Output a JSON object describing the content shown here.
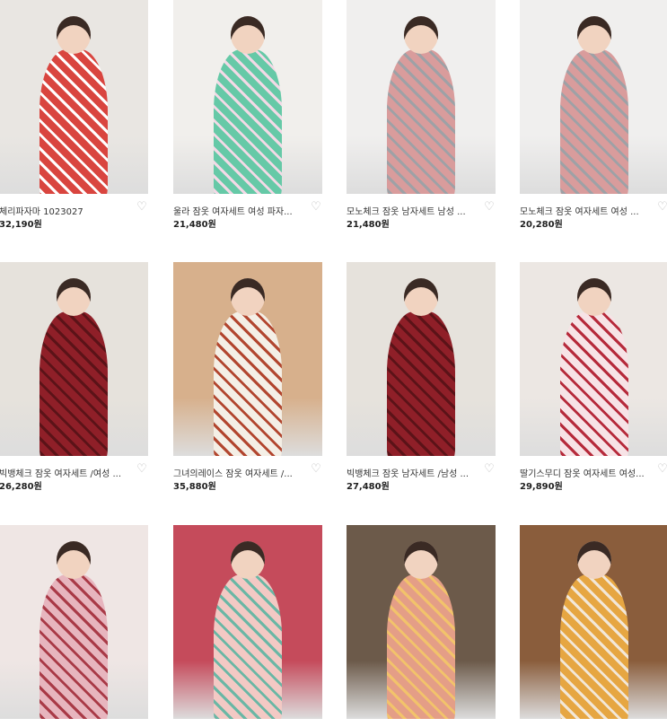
{
  "products": [
    {
      "title": "체리파자마 1023027",
      "price": "32,190원",
      "bg": "#e9e6e2",
      "outfit": "#d9453f",
      "accent": "#ffffff",
      "heart_icon": "heart-outline-icon"
    },
    {
      "title": "울라 잠옷 여자세트 여성 파자...",
      "price": "21,480원",
      "bg": "#f1efec",
      "outfit": "#66c9a7",
      "accent": "#f3d9e6",
      "heart_icon": "heart-outline-icon"
    },
    {
      "title": "모노체크 잠옷 남자세트 남성 ...",
      "price": "21,480원",
      "bg": "#f0efee",
      "outfit": "#d99c9c",
      "accent": "#9ea1a6",
      "heart_icon": "heart-outline-icon"
    },
    {
      "title": "모노체크 잠옷 여자세트 여성 ...",
      "price": "20,280원",
      "bg": "#f0efee",
      "outfit": "#d99c9c",
      "accent": "#9ea1a6",
      "heart_icon": "heart-outline-icon"
    },
    {
      "title": "빅뱅체크 잠옷 여자세트 /여성 ...",
      "price": "26,280원",
      "bg": "#e6e2dc",
      "outfit": "#8f1f28",
      "accent": "#5b1318",
      "heart_icon": "heart-outline-icon"
    },
    {
      "title": "그녀의레이스 잠옷 여자세트 /...",
      "price": "35,880원",
      "bg": "#d7b08c",
      "outfit": "#f4efe6",
      "accent": "#b2462f",
      "heart_icon": "heart-outline-icon"
    },
    {
      "title": "빅뱅체크 잠옷 남자세트 /남성 ...",
      "price": "27,480원",
      "bg": "#e6e2dc",
      "outfit": "#8f1f28",
      "accent": "#5b1318",
      "heart_icon": "heart-outline-icon"
    },
    {
      "title": "딸기스무디 잠옷 여자세트 여성...",
      "price": "29,890원",
      "bg": "#ece7e3",
      "outfit": "#f7e3e6",
      "accent": "#b62a3b",
      "heart_icon": "heart-outline-icon"
    },
    {
      "title": "",
      "price": "",
      "bg": "#efe6e4",
      "outfit": "#e7b5be",
      "accent": "#a93a47",
      "heart_icon": ""
    },
    {
      "title": "",
      "price": "",
      "bg": "#c54b5b",
      "outfit": "#f3c9c4",
      "accent": "#6ab7a5",
      "heart_icon": ""
    },
    {
      "title": "",
      "price": "",
      "bg": "#6c5a4a",
      "outfit": "#e49e87",
      "accent": "#f2c36b",
      "heart_icon": ""
    },
    {
      "title": "",
      "price": "",
      "bg": "#8a5d3c",
      "outfit": "#e6a642",
      "accent": "#f2e7d8",
      "heart_icon": ""
    }
  ]
}
